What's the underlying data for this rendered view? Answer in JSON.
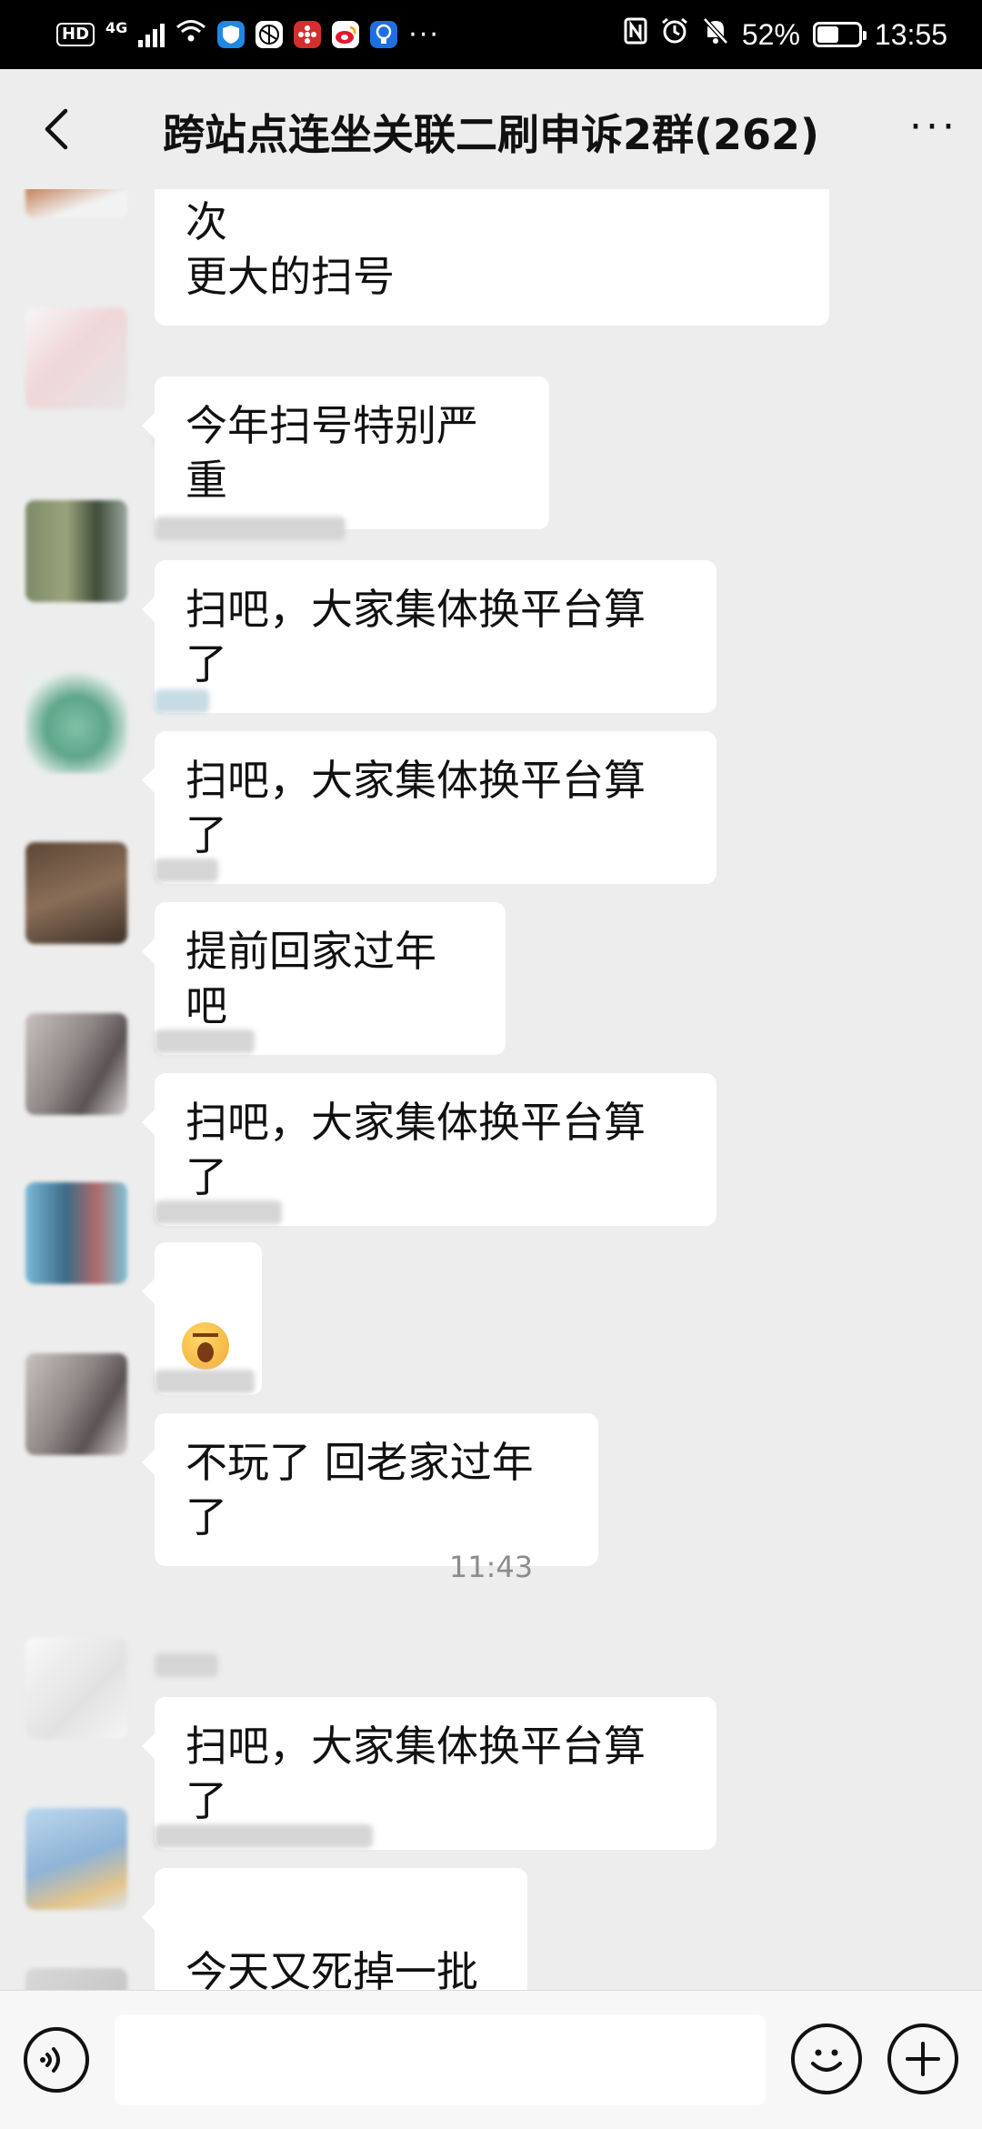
{
  "status_bar": {
    "hd": "HD",
    "network": "4G",
    "battery_percent": "52%",
    "battery_level": 0.52,
    "time": "13:55",
    "more": "···"
  },
  "header": {
    "title": "跨站点连坐关联二刷申诉2群(262)",
    "more": "···"
  },
  "messages": [
    {
      "text": "有内部消息称：十二月份会来一次\n更大的扫号"
    },
    {
      "text": "今年扫号特别严重"
    },
    {
      "text": "扫吧，大家集体换平台算了"
    },
    {
      "text": "扫吧，大家集体换平台算了"
    },
    {
      "text": "提前回家过年吧"
    },
    {
      "text": "扫吧，大家集体换平台算了"
    },
    {
      "text": "",
      "emoji": "yawn-emoji"
    },
    {
      "text": "不玩了 回老家过年了"
    },
    {
      "text": "扫吧，大家集体换平台算了"
    },
    {
      "text": "今天又死掉一批",
      "emoji": "grimace-emoji"
    }
  ],
  "timestamp": "11:43",
  "input_bar": {
    "placeholder": ""
  },
  "icons": {
    "back": "chevron-left-icon",
    "voice": "voice-icon",
    "emoji": "smiley-icon",
    "plus": "plus-icon"
  }
}
